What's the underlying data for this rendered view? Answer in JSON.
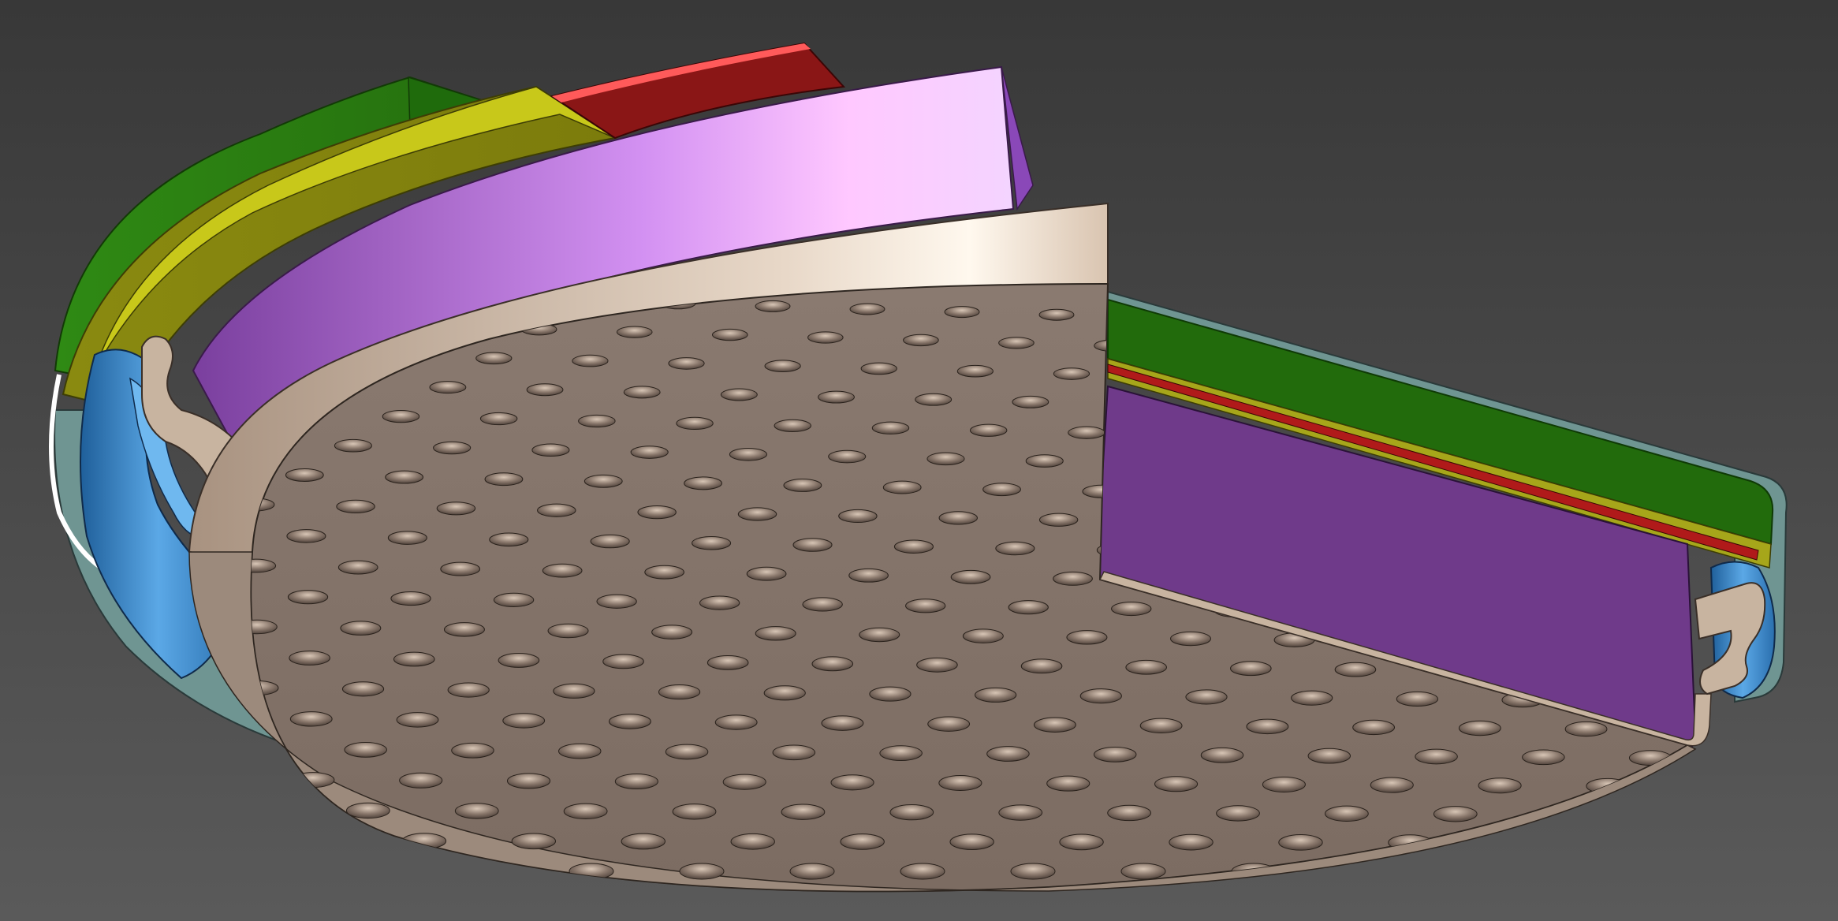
{
  "scene": {
    "kind": "cad-section-view",
    "background_top": "#3a3a3a",
    "background_bottom": "#5a5a5a",
    "parts": [
      {
        "name": "outer-shell",
        "color": "#5f8f8c"
      },
      {
        "name": "green-layer",
        "color": "#2c7a10"
      },
      {
        "name": "yellow-layer",
        "color": "#a6a61a"
      },
      {
        "name": "red-layer",
        "color": "#8a1616"
      },
      {
        "name": "purple-block",
        "color": "#9b59c7"
      },
      {
        "name": "blue-gasket",
        "color": "#3f8fd6"
      },
      {
        "name": "tan-clip",
        "color": "#c8b4a0"
      },
      {
        "name": "dimpled-plate",
        "color": "#8c7b70"
      }
    ]
  }
}
